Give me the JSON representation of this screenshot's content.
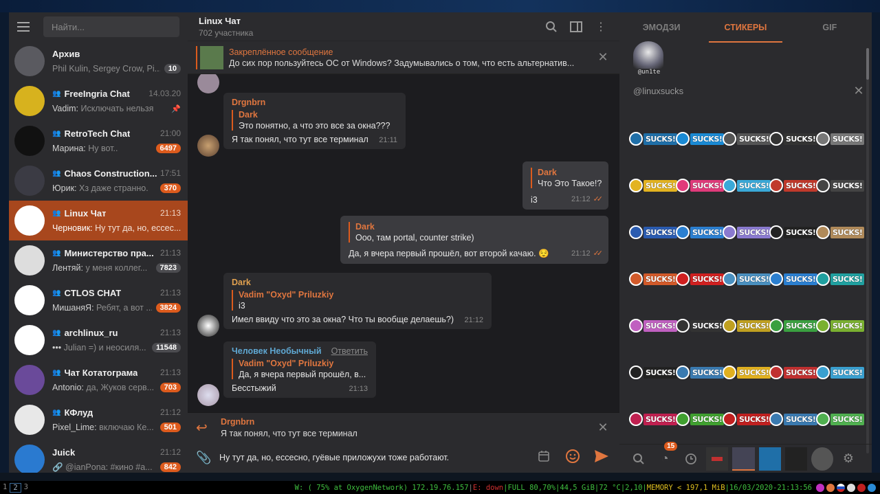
{
  "left": {
    "search_placeholder": "Найти...",
    "chats": [
      {
        "name": "Архив",
        "group": false,
        "time": "",
        "sender": "",
        "preview": "Phil Kulin, Sergey Crow, Pi...",
        "badge": "10",
        "badge_muted": true,
        "pinned": false,
        "color": "#5a5a60"
      },
      {
        "name": "FreeIngria Chat",
        "group": true,
        "time": "14.03.20",
        "sender": "Vadim:",
        "preview": " Исключать нельзя",
        "badge": "",
        "badge_muted": false,
        "pinned": true,
        "color": "#d7b21e"
      },
      {
        "name": "RetroTech Chat",
        "group": true,
        "time": "21:00",
        "sender": "Марина:",
        "preview": " Ну вот..",
        "badge": "6497",
        "badge_muted": false,
        "pinned": false,
        "color": "#111111"
      },
      {
        "name": "Chaos Construction...",
        "group": true,
        "time": "17:51",
        "sender": "Юрик:",
        "preview": " Хз даже странно.",
        "badge": "370",
        "badge_muted": false,
        "pinned": false,
        "color": "#3b3b44"
      },
      {
        "name": "Linux Чат",
        "group": true,
        "time": "21:13",
        "sender": "Черновик:",
        "preview": " Ну тут да, но, ессес...",
        "badge": "",
        "badge_muted": false,
        "pinned": false,
        "color": "#ffffff",
        "active": true
      },
      {
        "name": "Министерство пра...",
        "group": true,
        "time": "21:13",
        "sender": "Лентяй:",
        "preview": " у меня коллег...",
        "badge": "7823",
        "badge_muted": true,
        "pinned": false,
        "color": "#dddddd"
      },
      {
        "name": "CTLOS CHAT",
        "group": true,
        "time": "21:13",
        "sender": "МишаняЯ:",
        "preview": " Ребят, а вот ...",
        "badge": "3824",
        "badge_muted": false,
        "pinned": false,
        "color": "#ffffff"
      },
      {
        "name": "archlinux_ru",
        "group": true,
        "time": "21:13",
        "sender": "•••",
        "preview": " Julian =) и неосиля...",
        "badge": "11548",
        "badge_muted": true,
        "pinned": false,
        "color": "#ffffff"
      },
      {
        "name": "Чат Котатограма",
        "group": true,
        "time": "21:13",
        "sender": "Antonio:",
        "preview": " да, Жуков серв...",
        "badge": "703",
        "badge_muted": false,
        "pinned": false,
        "color": "#6a4a9a"
      },
      {
        "name": "КФлуд",
        "group": true,
        "time": "21:12",
        "sender": "Pixel_Lime:",
        "preview": " включаю Ке...",
        "badge": "501",
        "badge_muted": false,
        "pinned": false,
        "color": "#e8e8e8"
      },
      {
        "name": "Juick",
        "group": false,
        "time": "21:12",
        "sender": "🔗",
        "preview": " @ianPona: #кино #a...",
        "badge": "842",
        "badge_muted": false,
        "pinned": false,
        "color": "#2a7ad0"
      }
    ]
  },
  "chat": {
    "title": "Linux Чат",
    "subtitle": "702 участника",
    "pinned_title": "Закреплённое сообщение",
    "pinned_text": "До сих пор пользуйтесь ОС от Windows? Задумывались о том, что есть альтернатив...",
    "messages": [
      {
        "sender": "Drgnbrn",
        "sender_color": "#e0763f",
        "reply_name": "Dark",
        "reply_text": "Это понятно, а что это все за окна???",
        "text": "Я так понял, что тут все терминал",
        "time": "21:11",
        "out": false
      },
      {
        "sender": "",
        "reply_name": "Dark",
        "reply_text": "Что Это Такое!?",
        "text": "i3",
        "time": "21:12",
        "out": true
      },
      {
        "sender": "",
        "reply_name": "Dark",
        "reply_text": "Ооо, там portal, counter strike)",
        "text": "Да, я вчера первый прошёл, вот второй качаю. 😌",
        "time": "21:12",
        "out": true
      },
      {
        "sender": "Dark",
        "sender_color": "#e0a04f",
        "reply_name": "Vadim \"Oxyd\" Priluzkiy",
        "reply_text": "i3",
        "text": "Имел ввиду что это за окна? Что ты вообще делаешь?)",
        "time": "21:12",
        "out": false
      },
      {
        "sender": "Человек Необычный",
        "sender_color": "#5fa8d3",
        "action": "Ответить",
        "reply_name": "Vadim \"Oxyd\" Priluzkiy",
        "reply_text": "Да, я вчера первый прошёл, в...",
        "text": "Бесстыжий",
        "time": "21:13",
        "out": false
      }
    ],
    "reply_to_name": "Drgnbrn",
    "reply_to_text": "Я так понял, что тут все терминал",
    "draft": "Ну тут да, но, ессесно, гуёвые приложухи тоже работают."
  },
  "panel": {
    "tabs": [
      "ЭМОДЗИ",
      "СТИКЕРЫ",
      "GIF"
    ],
    "active_tab": 1,
    "top_sticker_caption": "@un1te",
    "pack_name": "@linuxsucks",
    "sticker_text": "SUCKS!",
    "sticker_colors": [
      [
        "#1f6fa8",
        "#1a8ad4",
        "#555555",
        "#333333",
        "#777777"
      ],
      [
        "#e3b320",
        "#e03a7a",
        "#3aa9d8",
        "#c0392b",
        "#444444"
      ],
      [
        "#2a5bb0",
        "#2b7fd0",
        "#8a7ad0",
        "#222222",
        "#b08a5a"
      ],
      [
        "#d25a2a",
        "#d02020",
        "#4a90c0",
        "#2b7fd0",
        "#20a0a0"
      ],
      [
        "#c060c0",
        "#333333",
        "#c0a020",
        "#3aa040",
        "#7ab030"
      ],
      [
        "#222222",
        "#3a7ab0",
        "#e0b020",
        "#c03030",
        "#3aa0d0"
      ],
      [
        "#c02050",
        "#40a030",
        "#c02020",
        "#3a7ab0",
        "#50b050"
      ]
    ],
    "recent_badge": "15"
  },
  "tray": {
    "workspaces": [
      "1",
      "2",
      "3"
    ],
    "active_ws": 1,
    "status": [
      {
        "t": "W: ( 75% at OxygenNetwork) 172.19.76.157",
        "c": "#3fbf3f"
      },
      {
        "t": "|",
        "c": "#888"
      },
      {
        "t": "E: down",
        "c": "#d03030"
      },
      {
        "t": "|FULL 80,70%|44,5 GiB|72 °C|2,10|",
        "c": "#3fbf3f"
      },
      {
        "t": "MEMORY < 197,1 MiB",
        "c": "#e0c020"
      },
      {
        "t": "|16/03/2020-21:13:56",
        "c": "#3fbf3f"
      }
    ]
  }
}
